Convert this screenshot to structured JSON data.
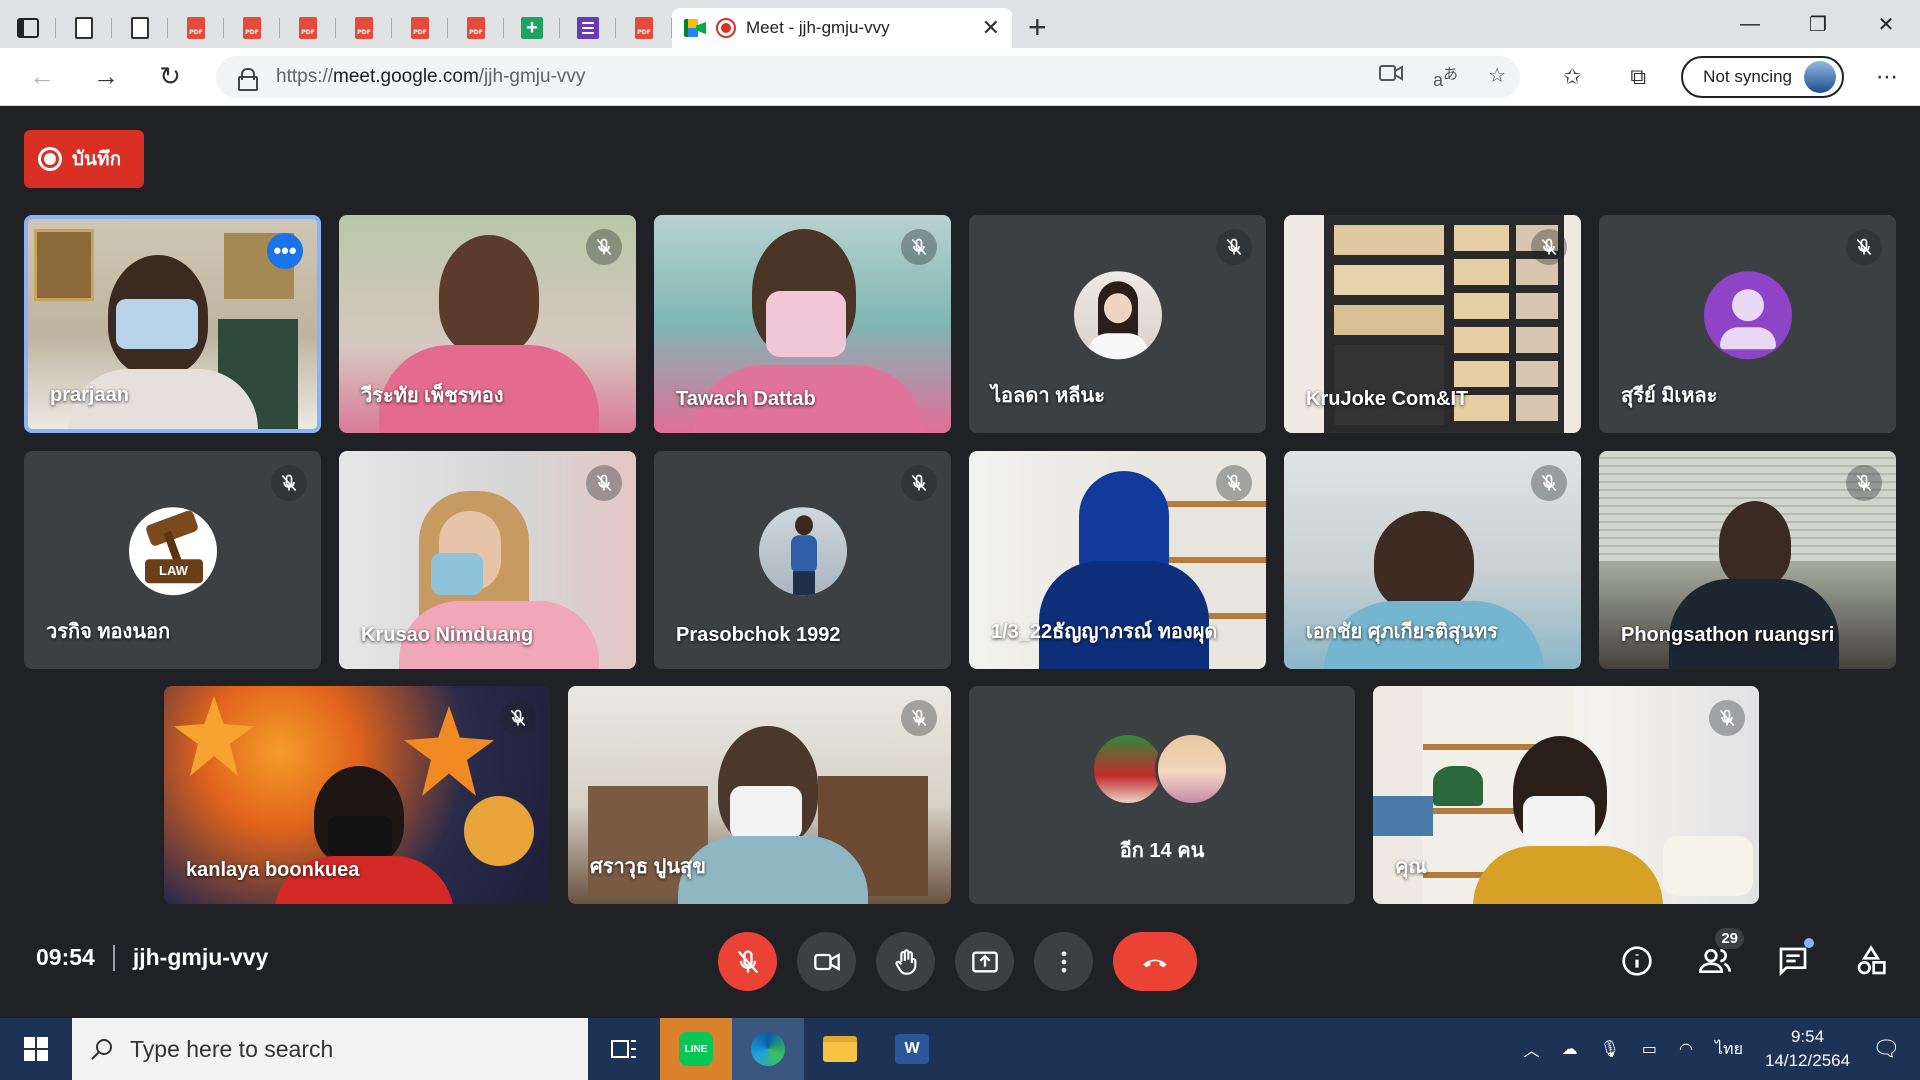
{
  "browser": {
    "active_tab_title": "Meet - jjh-gmju-vvy",
    "url_prefix": "https://",
    "url_host": "meet.google.com",
    "url_path": "/jjh-gmju-vvy",
    "profile_label": "Not syncing"
  },
  "meet": {
    "record_label": "บันทึก",
    "time": "09:54",
    "meeting_code": "jjh-gmju-vvy",
    "participant_count": "29",
    "participants": [
      {
        "name": "prarjaan"
      },
      {
        "name": "วีระทัย เพ็ชรทอง"
      },
      {
        "name": "Tawach Dattab"
      },
      {
        "name": "ไอลดา หลีนะ"
      },
      {
        "name": "KruJoke Com&IT"
      },
      {
        "name": "สุรีย์ มิเหละ"
      },
      {
        "name": "วรกิจ ทองนอก"
      },
      {
        "name": "Krusao Nimduang"
      },
      {
        "name": "Prasobchok 1992"
      },
      {
        "name": "1/3_22ธัญญาภรณ์ ทองผุด"
      },
      {
        "name": "เอกชัย ศุภเกียรติสุนทร"
      },
      {
        "name": "Phongsathon ruangsri"
      },
      {
        "name": "kanlaya boonkuea"
      },
      {
        "name": "ศราวุธ ปูนสุข"
      },
      {
        "name": "อีก 14 คน"
      },
      {
        "name": "คุณ"
      }
    ],
    "avatar_badge_text": "LAW"
  },
  "taskbar": {
    "search_placeholder": "Type here to search",
    "language": "ไทย",
    "clock_time": "9:54",
    "clock_date": "14/12/2564"
  },
  "colors": {
    "meet_bg": "#202124",
    "tile_bg": "#3c4043",
    "danger": "#ea4335",
    "accent": "#8ab4f8"
  }
}
